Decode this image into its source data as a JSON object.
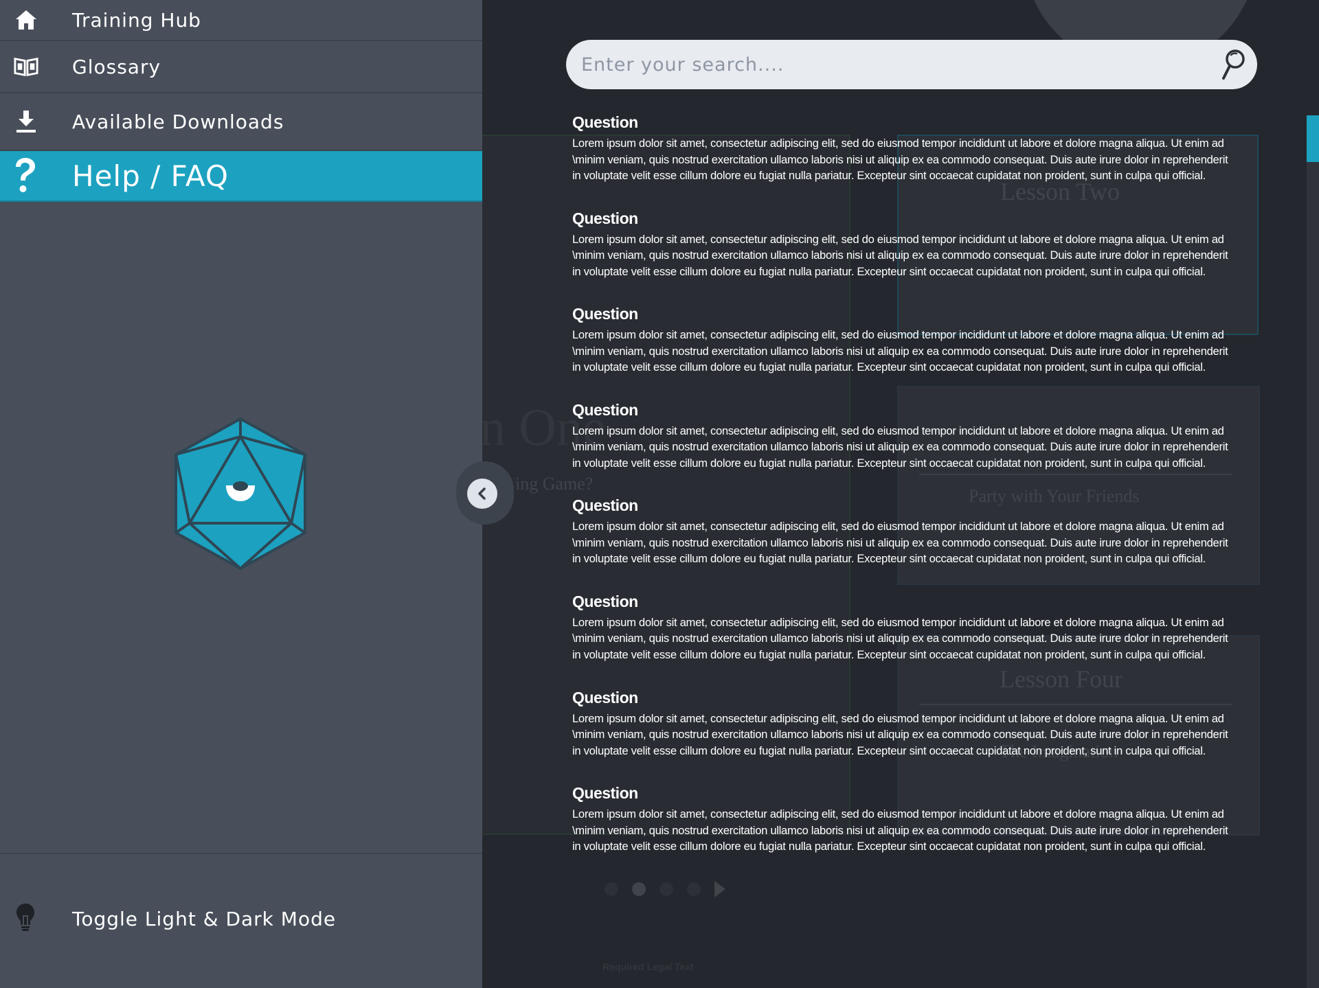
{
  "sidebar": {
    "items": [
      {
        "label": "Training Hub",
        "icon": "home-icon"
      },
      {
        "label": "Glossary",
        "icon": "book-icon"
      },
      {
        "label": "Available Downloads",
        "icon": "download-icon"
      },
      {
        "label": "Help / FAQ",
        "icon": "question-icon",
        "active": true
      }
    ],
    "toggle_label": "Toggle Light & Dark Mode",
    "accent": "#1ca2c0"
  },
  "search": {
    "placeholder": "Enter your search...."
  },
  "faq": [
    {
      "question": "Question",
      "answer": "Lorem ipsum dolor sit amet, consectetur adipiscing elit, sed do eiusmod tempor incididunt ut labore et dolore magna aliqua. Ut enim ad \\minim veniam, quis nostrud exercitation ullamco laboris nisi ut aliquip ex ea commodo consequat. Duis aute irure dolor in reprehenderit in voluptate velit esse cillum dolore eu fugiat nulla pariatur. Excepteur sint occaecat cupidatat non proident, sunt in culpa qui official."
    },
    {
      "question": "Question",
      "answer": "Lorem ipsum dolor sit amet, consectetur adipiscing elit, sed do eiusmod tempor incididunt ut labore et dolore magna aliqua. Ut enim ad \\minim veniam, quis nostrud exercitation ullamco laboris nisi ut aliquip ex ea commodo consequat. Duis aute irure dolor in reprehenderit in voluptate velit esse cillum dolore eu fugiat nulla pariatur. Excepteur sint occaecat cupidatat non proident, sunt in culpa qui official."
    },
    {
      "question": "Question",
      "answer": "Lorem ipsum dolor sit amet, consectetur adipiscing elit, sed do eiusmod tempor incididunt ut labore et dolore magna aliqua. Ut enim ad \\minim veniam, quis nostrud exercitation ullamco laboris nisi ut aliquip ex ea commodo consequat. Duis aute irure dolor in reprehenderit in voluptate velit esse cillum dolore eu fugiat nulla pariatur. Excepteur sint occaecat cupidatat non proident, sunt in culpa qui official."
    },
    {
      "question": "Question",
      "answer": "Lorem ipsum dolor sit amet, consectetur adipiscing elit, sed do eiusmod tempor incididunt ut labore et dolore magna aliqua. Ut enim ad \\minim veniam, quis nostrud exercitation ullamco laboris nisi ut aliquip ex ea commodo consequat. Duis aute irure dolor in reprehenderit in voluptate velit esse cillum dolore eu fugiat nulla pariatur. Excepteur sint occaecat cupidatat non proident, sunt in culpa qui official."
    },
    {
      "question": "Question",
      "answer": "Lorem ipsum dolor sit amet, consectetur adipiscing elit, sed do eiusmod tempor incididunt ut labore et dolore magna aliqua. Ut enim ad \\minim veniam, quis nostrud exercitation ullamco laboris nisi ut aliquip ex ea commodo consequat. Duis aute irure dolor in reprehenderit in voluptate velit esse cillum dolore eu fugiat nulla pariatur. Excepteur sint occaecat cupidatat non proident, sunt in culpa qui official."
    },
    {
      "question": "Question",
      "answer": "Lorem ipsum dolor sit amet, consectetur adipiscing elit, sed do eiusmod tempor incididunt ut labore et dolore magna aliqua. Ut enim ad \\minim veniam, quis nostrud exercitation ullamco laboris nisi ut aliquip ex ea commodo consequat. Duis aute irure dolor in reprehenderit in voluptate velit esse cillum dolore eu fugiat nulla pariatur. Excepteur sint occaecat cupidatat non proident, sunt in culpa qui official."
    },
    {
      "question": "Question",
      "answer": "Lorem ipsum dolor sit amet, consectetur adipiscing elit, sed do eiusmod tempor incididunt ut labore et dolore magna aliqua. Ut enim ad \\minim veniam, quis nostrud exercitation ullamco laboris nisi ut aliquip ex ea commodo consequat. Duis aute irure dolor in reprehenderit in voluptate velit esse cillum dolore eu fugiat nulla pariatur. Excepteur sint occaecat cupidatat non proident, sunt in culpa qui official."
    },
    {
      "question": "Question",
      "answer": "Lorem ipsum dolor sit amet, consectetur adipiscing elit, sed do eiusmod tempor incididunt ut labore et dolore magna aliqua. Ut enim ad \\minim veniam, quis nostrud exercitation ullamco laboris nisi ut aliquip ex ea commodo consequat. Duis aute irure dolor in reprehenderit in voluptate velit esse cillum dolore eu fugiat nulla pariatur. Excepteur sint occaecat cupidatat non proident, sunt in culpa qui official."
    }
  ],
  "background": {
    "lesson_two": "Lesson Two",
    "party": "Party with Your Friends",
    "lesson_four": "Lesson Four",
    "imagination": "The Imagination",
    "hero": "n One",
    "hero_sub": "ing Game?",
    "legal": "Required Legal Text"
  }
}
